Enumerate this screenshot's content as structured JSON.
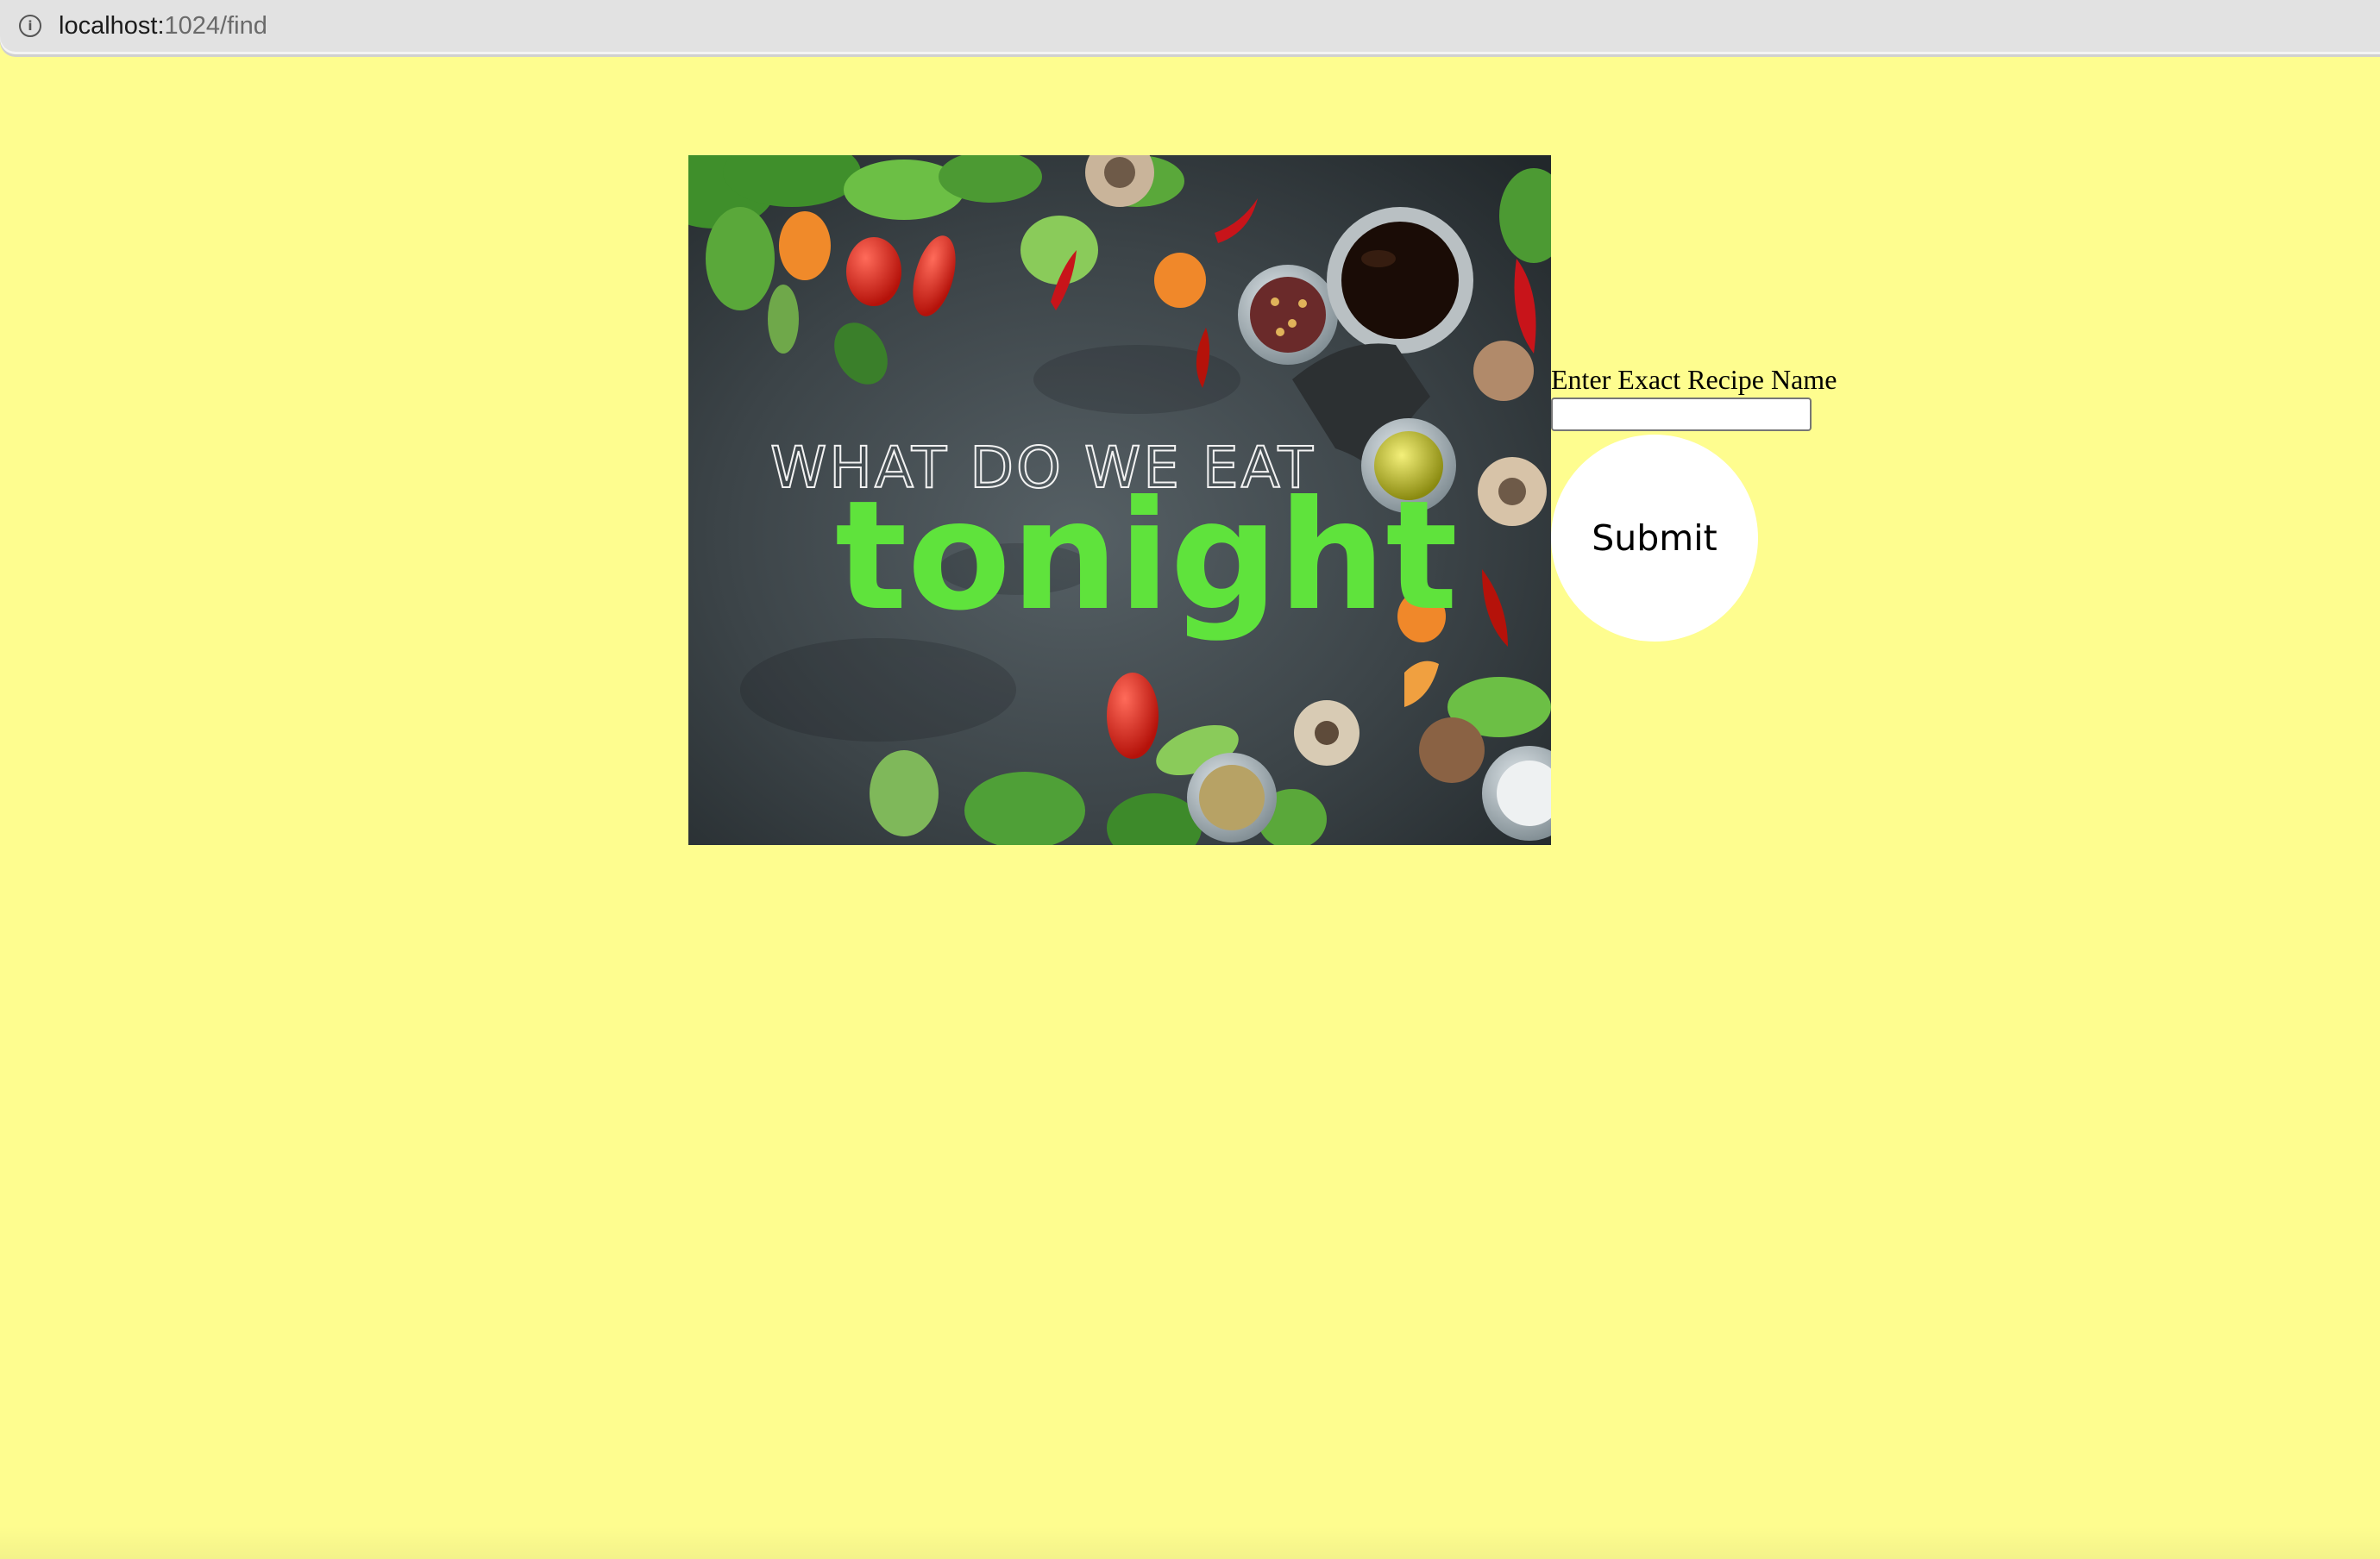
{
  "browser": {
    "url_host": "localhost:",
    "url_path": "1024/find"
  },
  "hero": {
    "line1": "WHAT DO WE EAT",
    "line2": "tonight"
  },
  "form": {
    "label": "Enter Exact Recipe Name",
    "input_value": "",
    "input_placeholder": "",
    "submit_label": "Submit"
  },
  "colors": {
    "page_background": "#fefd8f",
    "urlbar_background": "#e2e2e2",
    "hero_title_green": "#5fe33c",
    "submit_button": "#ffffff"
  }
}
